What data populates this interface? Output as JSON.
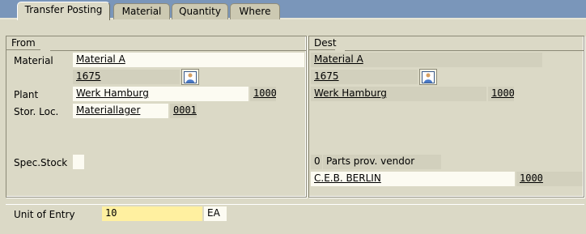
{
  "tabs": [
    "Transfer Posting",
    "Material",
    "Quantity",
    "Where"
  ],
  "from": {
    "title": "From",
    "material_label": "Material",
    "material_value": "Material A",
    "material_code": "1675",
    "plant_label": "Plant",
    "plant_value": "Werk Hamburg",
    "plant_code": "1000",
    "storloc_label": "Stor. Loc.",
    "storloc_value": "Materiallager",
    "storloc_code": "0001",
    "specstock_label": "Spec.Stock",
    "specstock_value": ""
  },
  "dest": {
    "title": "Dest",
    "material_value": "Material A",
    "material_code": "1675",
    "plant_value": "Werk Hamburg",
    "plant_code": "1000",
    "specstock_code": "0",
    "specstock_text": "Parts prov. vendor",
    "vendor_name": "C.E.B. BERLIN",
    "vendor_code": "1000"
  },
  "entry": {
    "label": "Unit of Entry",
    "quantity": "10",
    "unit": "EA"
  },
  "icons": {
    "picture": "picture-icon"
  }
}
